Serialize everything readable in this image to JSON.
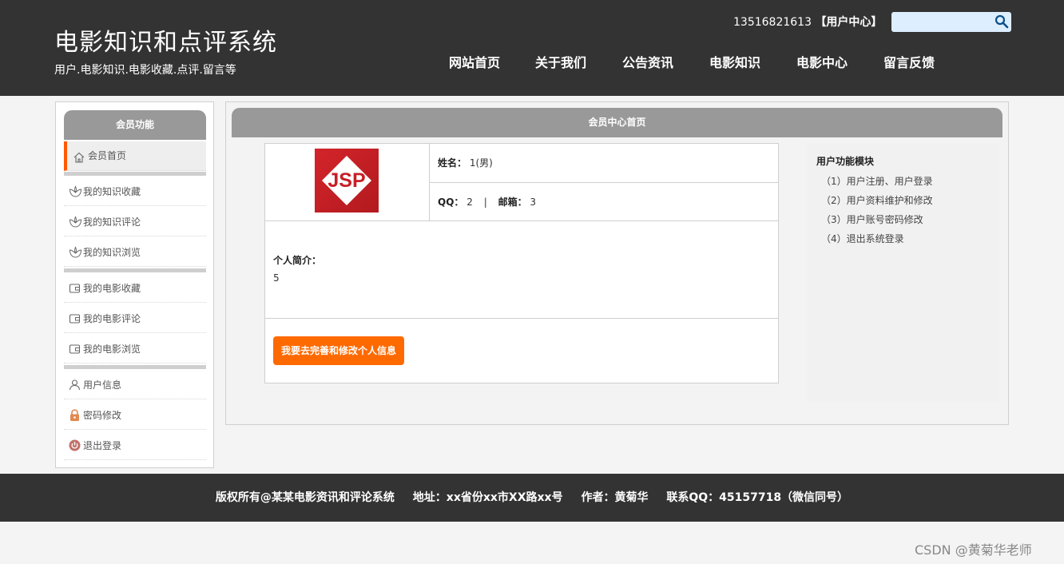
{
  "header": {
    "site_title": "电影知识和点评系统",
    "site_subtitle": "用户.电影知识.电影收藏.点评.留言等",
    "user_phone": "13516821613",
    "user_center_link": "【用户中心】",
    "search": {
      "placeholder": "",
      "value": ""
    }
  },
  "nav": [
    {
      "label": "网站首页"
    },
    {
      "label": "关于我们"
    },
    {
      "label": "公告资讯"
    },
    {
      "label": "电影知识"
    },
    {
      "label": "电影中心"
    },
    {
      "label": "留言反馈"
    }
  ],
  "sidebar": {
    "title": "会员功能",
    "items": [
      {
        "label": "会员首页",
        "icon": "home-icon"
      },
      {
        "label": "我的知识收藏",
        "icon": "lotus-icon"
      },
      {
        "label": "我的知识评论",
        "icon": "lotus-icon"
      },
      {
        "label": "我的知识浏览",
        "icon": "lotus-icon"
      },
      {
        "label": "我的电影收藏",
        "icon": "wallet-icon"
      },
      {
        "label": "我的电影评论",
        "icon": "wallet-icon"
      },
      {
        "label": "我的电影浏览",
        "icon": "wallet-icon"
      },
      {
        "label": "用户信息",
        "icon": "user-icon"
      },
      {
        "label": "密码修改",
        "icon": "lock-icon"
      },
      {
        "label": "退出登录",
        "icon": "power-icon"
      }
    ]
  },
  "main": {
    "title": "会员中心首页",
    "profile": {
      "avatar_text": "JSP",
      "name_label": "姓名：",
      "name_value": "1(男)",
      "qq_label": "QQ：",
      "qq_value": "2",
      "separator": "|",
      "email_label": "邮箱：",
      "email_value": "3",
      "intro_label": "个人简介：",
      "intro_value": "5",
      "edit_button": "我要去完善和修改个人信息"
    },
    "functions": {
      "title": "用户功能模块",
      "items": [
        "（1）用户注册、用户登录",
        "（2）用户资料维护和修改",
        "（3）用户账号密码修改",
        "（4）退出系统登录"
      ]
    }
  },
  "footer": {
    "copyright": "版权所有@某某电影资讯和评论系统",
    "address": "地址：xx省份xx市XX路xx号",
    "author": "作者：黄菊华",
    "contact": "联系QQ：45157718（微信同号）"
  },
  "watermark": "CSDN @黄菊华老师",
  "colors": {
    "header_bg": "#333333",
    "panel_head": "#999999",
    "accent": "#ff6a00",
    "active_marker": "#ff5a00"
  }
}
